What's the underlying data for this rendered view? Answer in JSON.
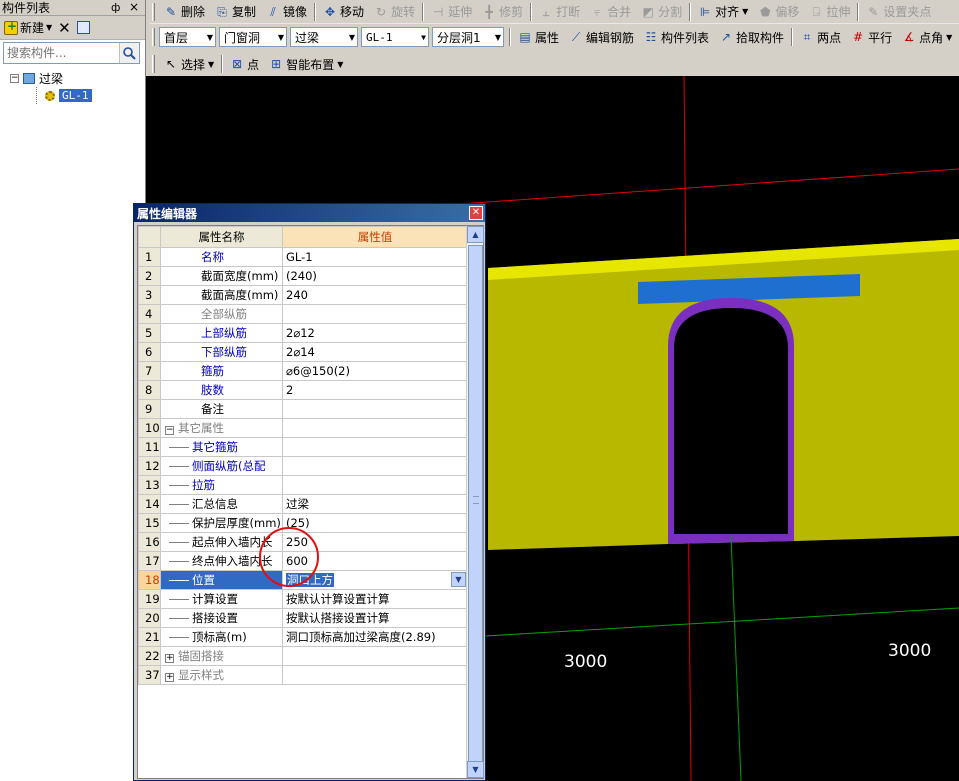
{
  "left_panel": {
    "title": "构件列表",
    "pin": "ф",
    "close": "×",
    "new_label": "新建",
    "search_placeholder": "搜索构件...",
    "tree": {
      "root": "过梁",
      "child": "GL-1"
    }
  },
  "toolbar1": {
    "delete": "删除",
    "copy": "复制",
    "mirror": "镜像",
    "move": "移动",
    "rotate": "旋转",
    "extend": "延伸",
    "trim": "修剪",
    "break": "打断",
    "merge": "合并",
    "split": "分割",
    "align": "对齐",
    "offset": "偏移",
    "stretch": "拉伸",
    "set_grip": "设置夹点"
  },
  "toolbar2": {
    "floor": "首层",
    "category": "门窗洞",
    "type": "过梁",
    "component": "GL-1",
    "layer": "分层洞1",
    "properties": "属性",
    "edit_rebar": "编辑钢筋",
    "component_list": "构件列表",
    "pick_component": "拾取构件",
    "two_points": "两点",
    "parallel": "平行",
    "point_angle": "点角"
  },
  "toolbar3": {
    "select": "选择",
    "point": "点",
    "smart_layout": "智能布置"
  },
  "canvas": {
    "dim_left": "3000",
    "dim_right": "3000"
  },
  "prop_editor": {
    "title": "属性编辑器",
    "header": {
      "name": "属性名称",
      "value": "属性值"
    },
    "rows": [
      {
        "num": "1",
        "name": "名称",
        "value": "GL-1"
      },
      {
        "num": "2",
        "name": "截面宽度(mm)",
        "value": "(240)"
      },
      {
        "num": "3",
        "name": "截面高度(mm)",
        "value": "240"
      },
      {
        "num": "4",
        "name": "全部纵筋",
        "value": ""
      },
      {
        "num": "5",
        "name": "上部纵筋",
        "value": "2⌀12"
      },
      {
        "num": "6",
        "name": "下部纵筋",
        "value": "2⌀14"
      },
      {
        "num": "7",
        "name": "箍筋",
        "value": "⌀6@150(2)"
      },
      {
        "num": "8",
        "name": "肢数",
        "value": "2"
      },
      {
        "num": "9",
        "name": "备注",
        "value": ""
      },
      {
        "num": "10",
        "name": "其它属性",
        "value": ""
      },
      {
        "num": "11",
        "name": "其它箍筋",
        "value": ""
      },
      {
        "num": "12",
        "name": "侧面纵筋(总配",
        "value": ""
      },
      {
        "num": "13",
        "name": "拉筋",
        "value": ""
      },
      {
        "num": "14",
        "name": "汇总信息",
        "value": "过梁"
      },
      {
        "num": "15",
        "name": "保护层厚度(mm)",
        "value": "(25)"
      },
      {
        "num": "16",
        "name": "起点伸入墙内长",
        "value": "250"
      },
      {
        "num": "17",
        "name": "终点伸入墙内长",
        "value": "600"
      },
      {
        "num": "18",
        "name": "位置",
        "value": "洞口上方"
      },
      {
        "num": "19",
        "name": "计算设置",
        "value": "按默认计算设置计算"
      },
      {
        "num": "20",
        "name": "搭接设置",
        "value": "按默认搭接设置计算"
      },
      {
        "num": "21",
        "name": "顶标高(m)",
        "value": "洞口顶标高加过梁高度(2.89)"
      },
      {
        "num": "22",
        "name": "锚固搭接",
        "value": ""
      },
      {
        "num": "37",
        "name": "显示样式",
        "value": ""
      }
    ]
  },
  "colors": {
    "wall": "#b8b800",
    "wall_top": "#e6e600",
    "lintel": "#1f6fd0",
    "opening_frame": "#7a2fc0",
    "axis_red": "#e00000",
    "axis_green": "#00a000",
    "highlight_circle": "#e01010"
  }
}
